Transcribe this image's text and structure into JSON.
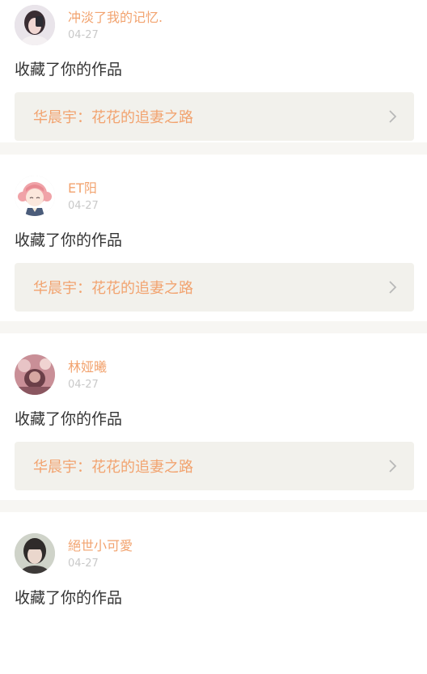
{
  "colors": {
    "accent": "#f2a36f",
    "card_bg": "#ffffff",
    "page_bg": "#f7f6f3",
    "work_bg": "#f2f1ec"
  },
  "notifications": [
    {
      "username": "冲淡了我的记忆.",
      "date": "04-27",
      "action": "收藏了你的作品",
      "work_title": "华晨宇：花花的追妻之路",
      "avatar_icon": "user-avatar-photo"
    },
    {
      "username": "ET阳",
      "date": "04-27",
      "action": "收藏了你的作品",
      "work_title": "华晨宇：花花的追妻之路",
      "avatar_icon": "user-avatar-anime-girl"
    },
    {
      "username": "林娅曦",
      "date": "04-27",
      "action": "收藏了你的作品",
      "work_title": "华晨宇：花花的追妻之路",
      "avatar_icon": "user-avatar-photo"
    },
    {
      "username": "絕世小可愛",
      "date": "04-27",
      "action": "收藏了你的作品",
      "work_title": "",
      "avatar_icon": "user-avatar-photo"
    }
  ]
}
